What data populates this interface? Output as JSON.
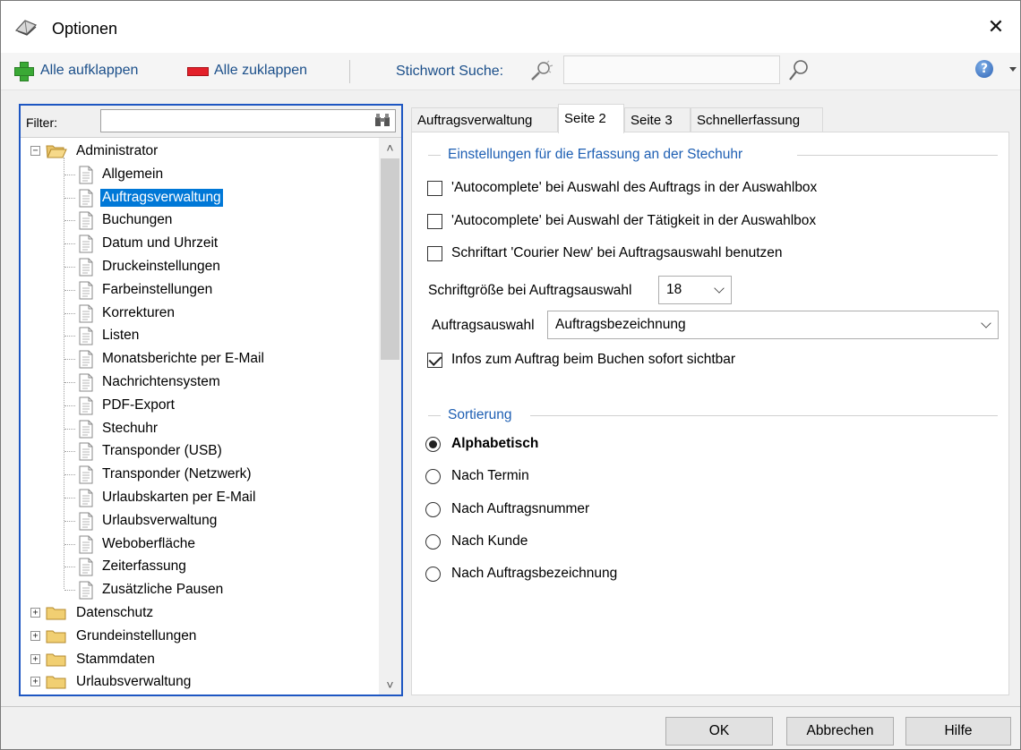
{
  "window": {
    "title": "Optionen"
  },
  "toolbar": {
    "expand_all": "Alle aufklappen",
    "collapse_all": "Alle zuklappen",
    "search_label": "Stichwort Suche:",
    "search_value": ""
  },
  "filter": {
    "label": "Filter:",
    "value": ""
  },
  "tree": {
    "root": "Administrator",
    "children": [
      "Allgemein",
      "Auftragsverwaltung",
      "Buchungen",
      "Datum und Uhrzeit",
      "Druckeinstellungen",
      "Farbeinstellungen",
      "Korrekturen",
      "Listen",
      "Monatsberichte per E-Mail",
      "Nachrichtensystem",
      "PDF-Export",
      "Stechuhr",
      "Transponder (USB)",
      "Transponder (Netzwerk)",
      "Urlaubskarten per E-Mail",
      "Urlaubsverwaltung",
      "Weboberfläche",
      "Zeiterfassung",
      "Zusätzliche Pausen"
    ],
    "selected": "Auftragsverwaltung",
    "collapsed_roots": [
      "Datenschutz",
      "Grundeinstellungen",
      "Stammdaten",
      "Urlaubsverwaltung"
    ]
  },
  "tabs": [
    {
      "label": "Auftragsverwaltung",
      "active": false
    },
    {
      "label": "Seite 2",
      "active": true
    },
    {
      "label": "Seite 3",
      "active": false
    },
    {
      "label": "Schnellerfassung",
      "active": false
    }
  ],
  "section_clock": {
    "title": "Einstellungen für die Erfassung an der Stechuhr",
    "options": [
      {
        "label": "'Autocomplete' bei Auswahl des Auftrags in der Auswahlbox",
        "checked": false
      },
      {
        "label": "'Autocomplete' bei Auswahl der Tätigkeit in der Auswahlbox",
        "checked": false
      },
      {
        "label": "Schriftart 'Courier New' bei Auftragsauswahl benutzen",
        "checked": false
      }
    ],
    "font_size_label": "Schriftgröße bei Auftragsauswahl",
    "font_size_value": "18",
    "order_selection_label": "Auftragsauswahl",
    "order_selection_value": "Auftragsbezeichnung",
    "info_option": {
      "label": "Infos zum Auftrag beim Buchen sofort sichtbar",
      "checked": true
    }
  },
  "section_sort": {
    "title": "Sortierung",
    "options": [
      {
        "label": "Alphabetisch",
        "checked": true
      },
      {
        "label": "Nach Termin",
        "checked": false
      },
      {
        "label": "Nach Auftragsnummer",
        "checked": false
      },
      {
        "label": "Nach Kunde",
        "checked": false
      },
      {
        "label": "Nach Auftragsbezeichnung",
        "checked": false
      }
    ]
  },
  "buttons": {
    "ok": "OK",
    "cancel": "Abbrechen",
    "help": "Hilfe"
  },
  "colors": {
    "accent": "#0078d7",
    "group_title": "#1e5fb3",
    "toolbar_text": "#1b4f8a"
  }
}
